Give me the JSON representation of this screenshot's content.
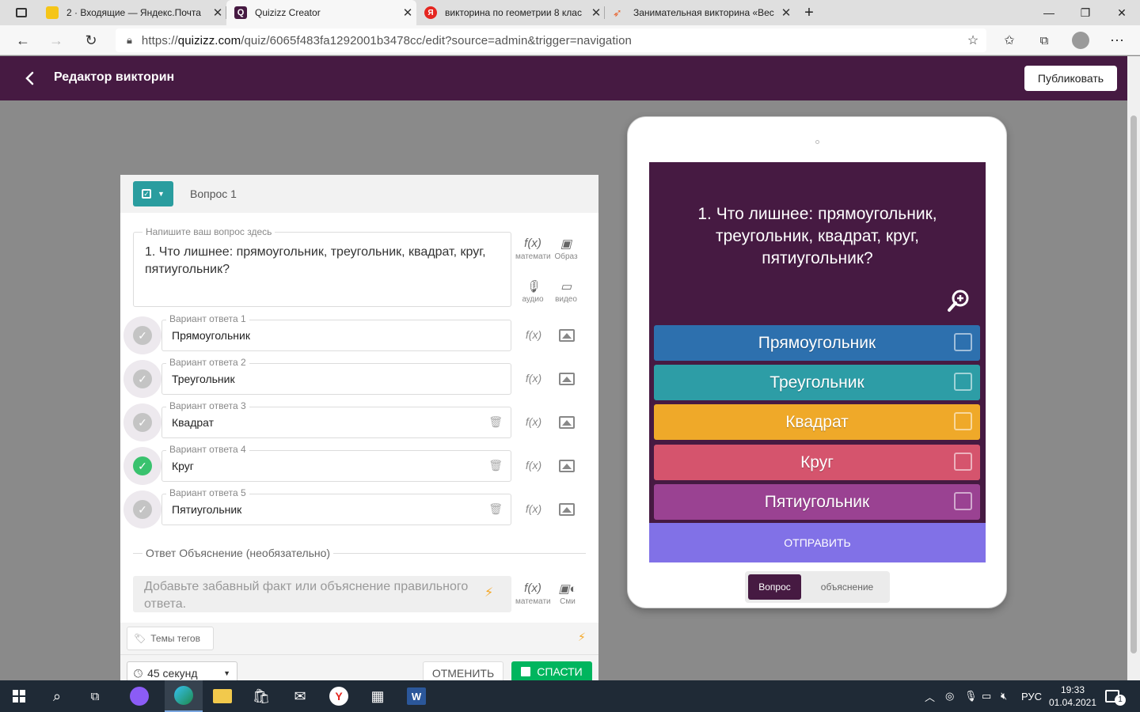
{
  "browser": {
    "tabs": [
      {
        "title": "2 · Входящие — Яндекс.Почта",
        "favicon_color": "#f5c518"
      },
      {
        "title": "Quizizz Creator",
        "favicon_color": "#461a42"
      },
      {
        "title": "викторина по геометрии 8 клас",
        "favicon_color": "#e52620"
      },
      {
        "title": "Занимательная викторина «Вес",
        "favicon_color": "#e8622c"
      }
    ],
    "new_tab_label": "+",
    "window_controls": {
      "minimize": "—",
      "maximize": "❐",
      "close": "✕"
    },
    "url_prefix": "https://",
    "url_host": "quizizz.com",
    "url_path": "/quiz/6065f483fa1292001b3478cc/edit?source=admin&trigger=navigation"
  },
  "header": {
    "title": "Редактор викторин",
    "publish_label": "Публиковать",
    "back_icon": "chevron-left-icon"
  },
  "editor": {
    "question_number": "Вопрос 1",
    "question_label": "Напишите ваш вопрос здесь",
    "question_text": "1. Что лишнее: прямоугольник, треугольник, квадрат, круг, пятиугольник?",
    "tools": {
      "math_label": "математи",
      "image_label": "Образ",
      "audio_label": "аудио",
      "video_label": "видео"
    },
    "answers": [
      {
        "label": "Вариант ответа 1",
        "value": "Прямоугольник",
        "correct": false
      },
      {
        "label": "Вариант ответа 2",
        "value": "Треугольник",
        "correct": false
      },
      {
        "label": "Вариант ответа 3",
        "value": "Квадрат",
        "correct": false
      },
      {
        "label": "Вариант ответа 4",
        "value": "Круг",
        "correct": true
      },
      {
        "label": "Вариант ответа 5",
        "value": "Пятиугольник",
        "correct": false
      }
    ],
    "explanation_title": "Ответ Объяснение (необязательно)",
    "explanation_placeholder": "Добавьте забавный факт или объяснение правильного ответа.",
    "explanation_math_label": "математи",
    "explanation_media_label": "Сми",
    "tags_label": "Темы тегов",
    "timer_value": "45 секунд",
    "cancel_label": "ОТМЕНИТЬ",
    "save_label": "СПАСТИ"
  },
  "preview": {
    "question_text": "1. Что лишнее: прямоугольник, треугольник, квадрат, круг, пятиугольник?",
    "options": [
      {
        "text": "Прямоугольник",
        "color": "#2d70ae"
      },
      {
        "text": "Треугольник",
        "color": "#2d9da6"
      },
      {
        "text": "Квадрат",
        "color": "#efa929"
      },
      {
        "text": "Круг",
        "color": "#d5546d"
      },
      {
        "text": "Пятиугольник",
        "color": "#9a4292"
      }
    ],
    "submit_label": "ОТПРАВИТЬ",
    "mode_question": "Вопрос",
    "mode_explanation": "объяснение"
  },
  "taskbar": {
    "language": "РУС",
    "time": "19:33",
    "date": "01.04.2021",
    "notifications": "1"
  },
  "colors": {
    "brand_purple": "#461a42",
    "teal": "#2a9d9f",
    "save_green": "#00b55e",
    "submit_violet": "#8171e7"
  }
}
